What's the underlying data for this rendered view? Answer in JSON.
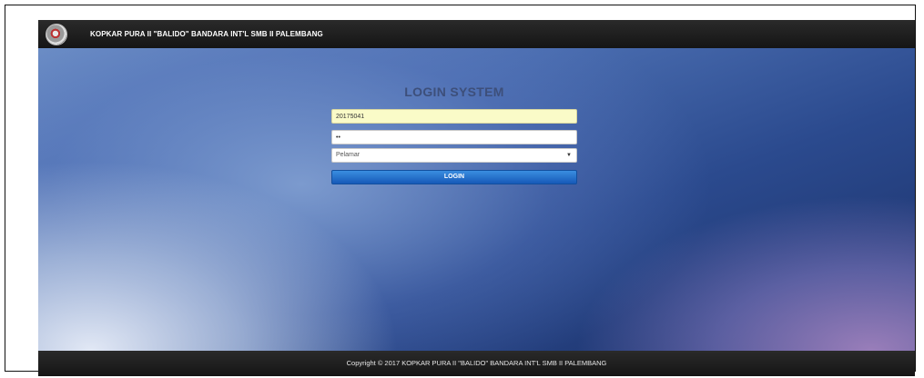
{
  "navbar": {
    "logo_icon": "cooperative-emblem-icon",
    "brand": "KOPKAR PURA II \"BALIDO\" BANDARA INT'L SMB II PALEMBANG"
  },
  "login": {
    "title": "LOGIN SYSTEM",
    "username_value": "20175041",
    "password_value": "••",
    "role_selected": "Pelamar",
    "submit_label": "LOGIN"
  },
  "footer": {
    "copyright": "Copyright © 2017 KOPKAR PURA II \"BALIDO\" BANDARA INT'L SMB II PALEMBANG"
  },
  "colors": {
    "navbar_bg": "#1e1e1e",
    "button_blue": "#1f6fcc",
    "username_autofill": "#fafbc8",
    "background_dark": "#1a2f66"
  }
}
